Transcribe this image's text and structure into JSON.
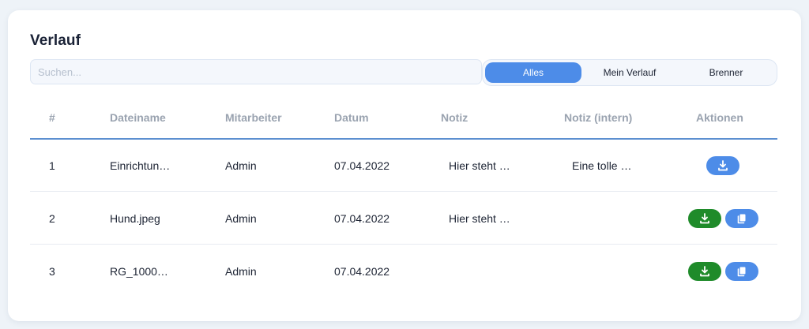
{
  "title": "Verlauf",
  "search": {
    "placeholder": "Suchen...",
    "value": ""
  },
  "filter_tabs": [
    {
      "label": "Alles",
      "active": true
    },
    {
      "label": "Mein Verlauf",
      "active": false
    },
    {
      "label": "Brenner",
      "active": false
    }
  ],
  "table": {
    "headers": {
      "num": "#",
      "file": "Dateiname",
      "employee": "Mitarbeiter",
      "date": "Datum",
      "note": "Notiz",
      "internal_note": "Notiz (intern)",
      "actions": "Aktionen"
    },
    "rows": [
      {
        "num": "1",
        "file": "Einrichtun…",
        "employee": "Admin",
        "date": "07.04.2022",
        "note": "Hier steht …",
        "internal_note": "Eine tolle …",
        "actions": [
          "download"
        ]
      },
      {
        "num": "2",
        "file": "Hund.jpeg",
        "employee": "Admin",
        "date": "07.04.2022",
        "note": "Hier steht …",
        "internal_note": "",
        "actions": [
          "download",
          "copy"
        ]
      },
      {
        "num": "3",
        "file": "RG_1000…",
        "employee": "Admin",
        "date": "07.04.2022",
        "note": "",
        "internal_note": "",
        "actions": [
          "download",
          "copy"
        ]
      }
    ]
  },
  "colors": {
    "accent": "#4d8ce8",
    "download_green": "#1f8b2a",
    "header_text": "#9aa3b0",
    "header_rule": "#5c8fd0"
  },
  "icons": {
    "download": "download-icon",
    "copy": "copy-icon"
  }
}
